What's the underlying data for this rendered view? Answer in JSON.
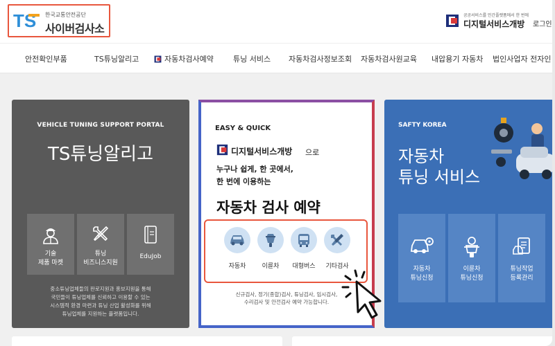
{
  "header": {
    "org_small": "한국교통안전공단",
    "org_name": "사이버검사소",
    "ts_logo_text": "TS",
    "digital_small": "공공서비스를 민간플랫폼에서 한 번에",
    "digital_name": "디지털서비스개방",
    "login": "로그인"
  },
  "nav": {
    "items": [
      {
        "label": "안전확인부품"
      },
      {
        "label": "TS튜닝알리고"
      },
      {
        "label": "자동차검사예약"
      },
      {
        "label": "튜닝 서비스"
      },
      {
        "label": "자동차검사정보조회"
      },
      {
        "label": "자동차검사원교육"
      },
      {
        "label": "내압용기 자동차"
      },
      {
        "label": "법인사업자 전자인"
      }
    ]
  },
  "card_tuning": {
    "subtitle": "VEHICLE TUNING SUPPORT PORTAL",
    "title": "TS튜닝알리고",
    "tiles": [
      {
        "line1": "기술",
        "line2": "제품 마켓"
      },
      {
        "line1": "튜닝",
        "line2": "비즈니스지원"
      },
      {
        "line1": "EduJob",
        "line2": ""
      }
    ],
    "desc": [
      "중소튜닝업체들의 판로지원과 홍보지원을 통해",
      "국민들이 튜닝업체를 신뢰하고 이용할 수 있는",
      "시스템적 환경 마련과 튜닝 산업 활성화를 위해",
      "튜닝업체를 지원하는 플랫폼입니다."
    ]
  },
  "card_reservation": {
    "eyebrow": "EASY & QUICK",
    "brand": "디지털서비스개방",
    "brand_suffix": "으로",
    "line1": "누구나 쉽게, 한 곳에서,",
    "line2": "한 번에 이용하는",
    "headline": "자동차 검사 예약",
    "services": [
      {
        "label": "자동차",
        "icon": "car-icon"
      },
      {
        "label": "이륜차",
        "icon": "motorcycle-icon"
      },
      {
        "label": "대형버스",
        "icon": "bus-icon"
      },
      {
        "label": "기타검사",
        "icon": "tools-icon"
      }
    ],
    "footer": [
      "신규검사, 정기(종합)검사, 튜닝검사, 임시검사,",
      "수리검사 및 안전검사 예약 가능합니다."
    ]
  },
  "card_service": {
    "subtitle": "SAFTY KOREA",
    "title1": "자동차",
    "title2": "튜닝 서비스",
    "tiles": [
      {
        "line1": "자동차",
        "line2": "튜닝신청",
        "icon": "car-gear-icon"
      },
      {
        "line1": "이륜차",
        "line2": "튜닝신청",
        "icon": "rider-icon"
      },
      {
        "line1": "튜닝작업",
        "line2": "등록관리",
        "icon": "document-icon"
      }
    ]
  },
  "colors": {
    "highlight": "#e8563d",
    "tuning_bg": "#595959",
    "service_bg": "#3b6fb6",
    "icon_circle": "#cfe1f3"
  }
}
